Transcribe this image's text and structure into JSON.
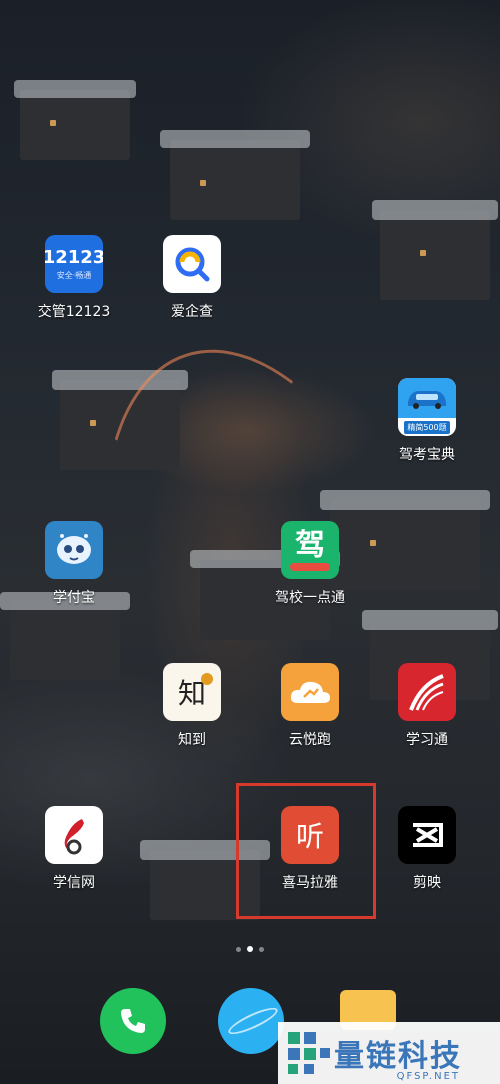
{
  "home_screen": {
    "apps": [
      {
        "id": "jiaoguan",
        "label": "交管12123",
        "icon_text_main": "12123",
        "icon_text_sub": "安全·畅通"
      },
      {
        "id": "aiqicha",
        "label": "爱企查"
      },
      {
        "id": "jiakaobaodian",
        "label": "驾考宝典",
        "icon_badge": "精简500题"
      },
      {
        "id": "xuefubao",
        "label": "学付宝"
      },
      {
        "id": "jiaxiao",
        "label": "驾校一点通",
        "icon_text_main": "驾"
      },
      {
        "id": "zhidao",
        "label": "知到",
        "icon_text_main": "知"
      },
      {
        "id": "yunyuepao",
        "label": "云悦跑"
      },
      {
        "id": "xuexitong",
        "label": "学习通"
      },
      {
        "id": "xuexinwang",
        "label": "学信网"
      },
      {
        "id": "ximalaya",
        "label": "喜马拉雅",
        "icon_text_main": "听"
      },
      {
        "id": "jianying",
        "label": "剪映"
      }
    ],
    "page_indicator": {
      "total": 3,
      "active": 1
    }
  },
  "dock": {
    "apps": [
      {
        "id": "phone",
        "icon": "phone-icon"
      },
      {
        "id": "browser",
        "icon": "browser-icon"
      },
      {
        "id": "notes",
        "icon": "notes-icon"
      }
    ]
  },
  "watermark": {
    "title": "量链科技",
    "subtitle": "QFSP.NET"
  },
  "colors": {
    "highlight": "#d63a2c",
    "jiaoguan_blue": "#1f6fe0",
    "ximalaya_red": "#e14d34",
    "xuexitong_red": "#d8262e"
  }
}
